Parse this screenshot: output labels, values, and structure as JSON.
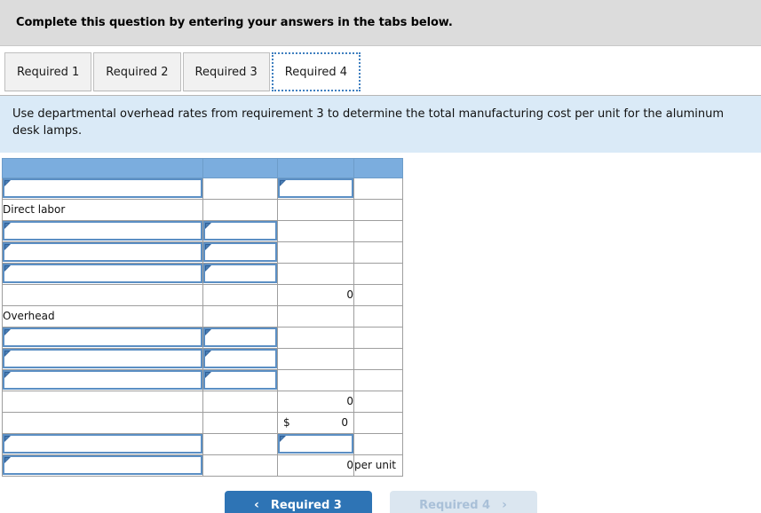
{
  "header": {
    "banner_text": "Complete this question by entering your answers in the tabs below."
  },
  "tabs": [
    {
      "label": "Required 1",
      "active": false
    },
    {
      "label": "Required 2",
      "active": false
    },
    {
      "label": "Required 3",
      "active": false
    },
    {
      "label": "Required 4",
      "active": true
    }
  ],
  "info": {
    "text": "Use departmental overhead rates from requirement 3 to determine the total manufacturing cost per unit for the aluminum desk lamps."
  },
  "worksheet": {
    "columns": [
      "",
      "",
      "",
      ""
    ],
    "rows": [
      {
        "type": "header",
        "cells": [
          {
            "kind": "header"
          },
          {
            "kind": "header"
          },
          {
            "kind": "header"
          },
          {
            "kind": "header"
          }
        ]
      },
      {
        "type": "data",
        "cells": [
          {
            "kind": "input",
            "value": ""
          },
          {
            "kind": "empty"
          },
          {
            "kind": "input",
            "value": ""
          },
          {
            "kind": "blank"
          }
        ]
      },
      {
        "type": "data",
        "cells": [
          {
            "kind": "label",
            "value": "Direct labor"
          },
          {
            "kind": "empty"
          },
          {
            "kind": "empty"
          },
          {
            "kind": "blank"
          }
        ]
      },
      {
        "type": "data",
        "cells": [
          {
            "kind": "input",
            "value": ""
          },
          {
            "kind": "input",
            "value": ""
          },
          {
            "kind": "empty"
          },
          {
            "kind": "blank"
          }
        ]
      },
      {
        "type": "data",
        "cells": [
          {
            "kind": "input",
            "value": ""
          },
          {
            "kind": "input",
            "value": ""
          },
          {
            "kind": "empty"
          },
          {
            "kind": "blank"
          }
        ]
      },
      {
        "type": "data",
        "cells": [
          {
            "kind": "input",
            "value": ""
          },
          {
            "kind": "input",
            "value": ""
          },
          {
            "kind": "empty"
          },
          {
            "kind": "blank"
          }
        ]
      },
      {
        "type": "subtotal",
        "cells": [
          {
            "kind": "empty"
          },
          {
            "kind": "empty"
          },
          {
            "kind": "number",
            "value": "0",
            "rule": "top"
          },
          {
            "kind": "blank"
          }
        ]
      },
      {
        "type": "data",
        "cells": [
          {
            "kind": "label",
            "value": "Overhead"
          },
          {
            "kind": "empty"
          },
          {
            "kind": "empty"
          },
          {
            "kind": "blank"
          }
        ]
      },
      {
        "type": "data",
        "cells": [
          {
            "kind": "input",
            "value": ""
          },
          {
            "kind": "input",
            "value": ""
          },
          {
            "kind": "empty"
          },
          {
            "kind": "blank"
          }
        ]
      },
      {
        "type": "data",
        "cells": [
          {
            "kind": "input",
            "value": ""
          },
          {
            "kind": "input",
            "value": ""
          },
          {
            "kind": "empty"
          },
          {
            "kind": "blank"
          }
        ]
      },
      {
        "type": "data",
        "cells": [
          {
            "kind": "input",
            "value": ""
          },
          {
            "kind": "input",
            "value": ""
          },
          {
            "kind": "empty"
          },
          {
            "kind": "blank"
          }
        ]
      },
      {
        "type": "subtotal",
        "cells": [
          {
            "kind": "empty"
          },
          {
            "kind": "empty"
          },
          {
            "kind": "number",
            "value": "0",
            "rule": "top"
          },
          {
            "kind": "blank"
          }
        ]
      },
      {
        "type": "total",
        "cells": [
          {
            "kind": "empty"
          },
          {
            "kind": "empty"
          },
          {
            "kind": "money",
            "currency": "$",
            "value": "0",
            "rule": "top"
          },
          {
            "kind": "blank"
          }
        ]
      },
      {
        "type": "data",
        "cells": [
          {
            "kind": "input",
            "value": ""
          },
          {
            "kind": "empty"
          },
          {
            "kind": "input",
            "value": ""
          },
          {
            "kind": "blank"
          }
        ]
      },
      {
        "type": "grand",
        "cells": [
          {
            "kind": "input",
            "value": ""
          },
          {
            "kind": "empty"
          },
          {
            "kind": "number",
            "value": "0",
            "rule": "double-bottom"
          },
          {
            "kind": "unit",
            "value": "per unit"
          }
        ]
      }
    ]
  },
  "footer": {
    "prev_label": "Required 3",
    "next_label": "Required 4",
    "prev_chevron": "‹",
    "next_chevron": "›"
  },
  "colors": {
    "header_row": "#7badde",
    "info_banner": "#daeaf7",
    "top_banner": "#dcdcdc",
    "input_border": "#5b8fc4",
    "btn_active": "#2e74b5",
    "btn_disabled": "#dbe6f0"
  }
}
